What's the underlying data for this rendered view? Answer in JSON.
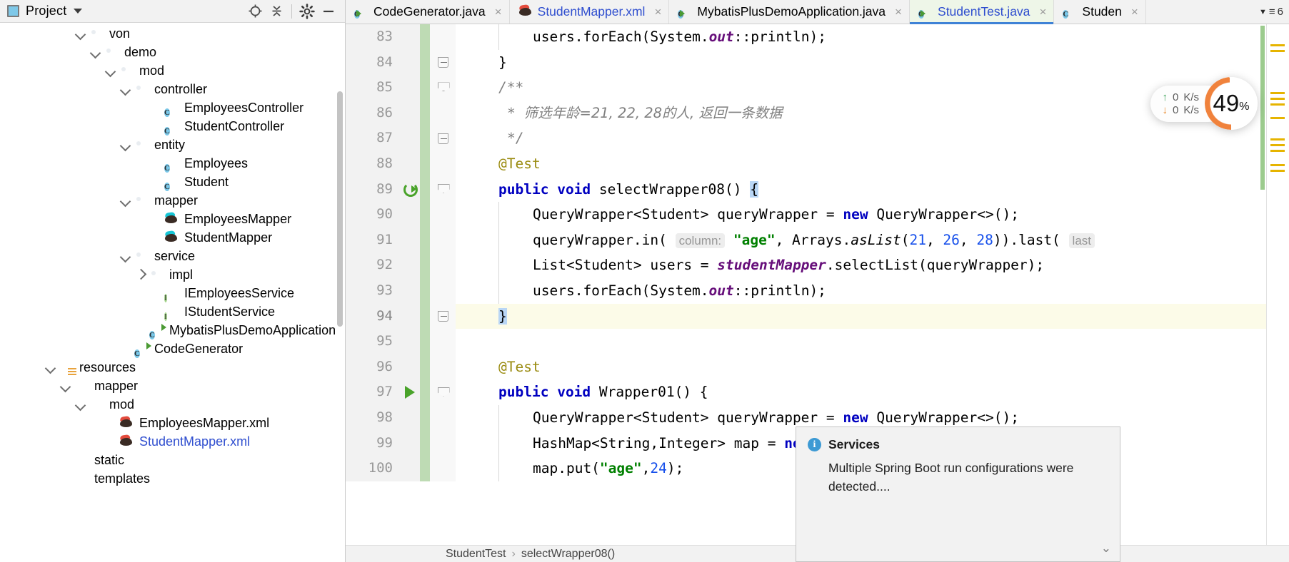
{
  "project_panel": {
    "title": "Project",
    "header_icons": [
      "project-window-icon",
      "chevron-down-icon",
      "locate-icon",
      "collapse-all-icon",
      "gear-icon",
      "minimize-icon"
    ],
    "tree": [
      {
        "label": "von",
        "indent": 5,
        "arrow": "down",
        "icon": "folder",
        "link": false
      },
      {
        "label": "demo",
        "indent": 6,
        "arrow": "down",
        "icon": "folder",
        "link": false
      },
      {
        "label": "mod",
        "indent": 7,
        "arrow": "down",
        "icon": "folder",
        "link": false
      },
      {
        "label": "controller",
        "indent": 8,
        "arrow": "down",
        "icon": "folder",
        "link": false
      },
      {
        "label": "EmployeesController",
        "indent": 10,
        "arrow": "none",
        "icon": "class",
        "link": false
      },
      {
        "label": "StudentController",
        "indent": 10,
        "arrow": "none",
        "icon": "class",
        "link": false
      },
      {
        "label": "entity",
        "indent": 8,
        "arrow": "down",
        "icon": "folder",
        "link": false
      },
      {
        "label": "Employees",
        "indent": 10,
        "arrow": "none",
        "icon": "class",
        "link": false
      },
      {
        "label": "Student",
        "indent": 10,
        "arrow": "none",
        "icon": "class",
        "link": false
      },
      {
        "label": "mapper",
        "indent": 8,
        "arrow": "down",
        "icon": "folder",
        "link": false
      },
      {
        "label": "EmployeesMapper",
        "indent": 10,
        "arrow": "none",
        "icon": "mybatis-cyan",
        "link": false
      },
      {
        "label": "StudentMapper",
        "indent": 10,
        "arrow": "none",
        "icon": "mybatis-cyan",
        "link": false
      },
      {
        "label": "service",
        "indent": 8,
        "arrow": "down",
        "icon": "folder",
        "link": false
      },
      {
        "label": "impl",
        "indent": 9,
        "arrow": "right",
        "icon": "folder",
        "link": false
      },
      {
        "label": "IEmployeesService",
        "indent": 10,
        "arrow": "none",
        "icon": "interface",
        "link": false
      },
      {
        "label": "IStudentService",
        "indent": 10,
        "arrow": "none",
        "icon": "interface",
        "link": false
      },
      {
        "label": "MybatisPlusDemoApplication",
        "indent": 9,
        "arrow": "none",
        "icon": "class-runnable",
        "link": false
      },
      {
        "label": "CodeGenerator",
        "indent": 8,
        "arrow": "none",
        "icon": "class-runnable",
        "link": false
      },
      {
        "label": "resources",
        "indent": 3,
        "arrow": "down",
        "icon": "folder-resources",
        "link": false
      },
      {
        "label": "mapper",
        "indent": 4,
        "arrow": "down",
        "icon": "folder-plain",
        "link": false
      },
      {
        "label": "mod",
        "indent": 5,
        "arrow": "down",
        "icon": "folder-plain",
        "link": false
      },
      {
        "label": "EmployeesMapper.xml",
        "indent": 7,
        "arrow": "none",
        "icon": "mybatis-red",
        "link": false
      },
      {
        "label": "StudentMapper.xml",
        "indent": 7,
        "arrow": "none",
        "icon": "mybatis-red",
        "link": true
      },
      {
        "label": "static",
        "indent": 4,
        "arrow": "none",
        "icon": "folder-plain",
        "link": false
      },
      {
        "label": "templates",
        "indent": 4,
        "arrow": "none",
        "icon": "folder-plain",
        "link": false
      }
    ]
  },
  "tabs": {
    "items": [
      {
        "label": "CodeGenerator.java",
        "icon": "class-runnable-icon",
        "link": false,
        "active": false,
        "close": "×"
      },
      {
        "label": "StudentMapper.xml",
        "icon": "mybatis-icon",
        "link": true,
        "active": false,
        "close": "×"
      },
      {
        "label": "MybatisPlusDemoApplication.java",
        "icon": "spring-class-icon",
        "link": false,
        "active": false,
        "close": "×"
      },
      {
        "label": "StudentTest.java",
        "icon": "test-class-icon",
        "link": true,
        "active": true,
        "close": "×"
      },
      {
        "label": "Studen",
        "icon": "class-icon",
        "link": false,
        "active": false,
        "close": "×"
      }
    ],
    "overflow_count": "6"
  },
  "editor": {
    "lines": [
      {
        "num": "83",
        "vcs": true,
        "fold": "none",
        "run": "none",
        "current": false,
        "guides": [
          1
        ]
      },
      {
        "num": "84",
        "vcs": true,
        "fold": "end",
        "run": "none",
        "current": false,
        "guides": []
      },
      {
        "num": "85",
        "vcs": true,
        "fold": "tri",
        "run": "none",
        "current": false,
        "guides": []
      },
      {
        "num": "86",
        "vcs": true,
        "fold": "none",
        "run": "none",
        "current": false,
        "guides": []
      },
      {
        "num": "87",
        "vcs": true,
        "fold": "end",
        "run": "none",
        "current": false,
        "guides": []
      },
      {
        "num": "88",
        "vcs": true,
        "fold": "none",
        "run": "none",
        "current": false,
        "guides": []
      },
      {
        "num": "89",
        "vcs": true,
        "fold": "tri",
        "run": "rerun",
        "current": false,
        "guides": []
      },
      {
        "num": "90",
        "vcs": true,
        "fold": "none",
        "run": "none",
        "current": false,
        "guides": [
          1
        ]
      },
      {
        "num": "91",
        "vcs": true,
        "fold": "none",
        "run": "none",
        "current": false,
        "guides": [
          1
        ]
      },
      {
        "num": "92",
        "vcs": true,
        "fold": "none",
        "run": "none",
        "current": false,
        "guides": [
          1
        ]
      },
      {
        "num": "93",
        "vcs": true,
        "fold": "none",
        "run": "none",
        "current": false,
        "guides": [
          1
        ]
      },
      {
        "num": "94",
        "vcs": true,
        "fold": "end",
        "run": "none",
        "current": true,
        "guides": []
      },
      {
        "num": "95",
        "vcs": true,
        "fold": "none",
        "run": "none",
        "current": false,
        "guides": []
      },
      {
        "num": "96",
        "vcs": true,
        "fold": "none",
        "run": "none",
        "current": false,
        "guides": []
      },
      {
        "num": "97",
        "vcs": true,
        "fold": "tri",
        "run": "play",
        "current": false,
        "guides": []
      },
      {
        "num": "98",
        "vcs": true,
        "fold": "none",
        "run": "none",
        "current": false,
        "guides": [
          1
        ]
      },
      {
        "num": "99",
        "vcs": true,
        "fold": "none",
        "run": "none",
        "current": false,
        "guides": [
          1
        ]
      },
      {
        "num": "100",
        "vcs": true,
        "fold": "none",
        "run": "none",
        "current": false,
        "guides": [
          1
        ]
      }
    ],
    "code": {
      "l83": "users.forEach(System.out::println);",
      "l84": "}",
      "l85": "/**",
      "l86_star": "*",
      "l86_text": "筛选年龄=21, 22, 28的人, 返回一条数据",
      "l87": "*/",
      "l88": "@Test",
      "l89_kw1": "public",
      "l89_kw2": "void",
      "l89_name": "selectWrapper08()",
      "l89_brace": "{",
      "l90_a": "QueryWrapper<Student> queryWrapper = ",
      "l90_new": "new",
      "l90_b": " QueryWrapper<>();",
      "l91_a": "queryWrapper.in(",
      "l91_hint": "column:",
      "l91_str": "\"age\"",
      "l91_b": ", Arrays.",
      "l91_m": "asList",
      "l91_c": "(",
      "l91_n1": "21",
      "l91_c2": ", ",
      "l91_n2": "26",
      "l91_c3": ", ",
      "l91_n3": "28",
      "l91_d": ")).last(",
      "l91_hint2": "last",
      "l92_a": "List<Student> users = ",
      "l92_field": "studentMapper",
      "l92_b": ".selectList(queryWrapper);",
      "l93": "users.forEach(System.out::println);",
      "l94": "}",
      "l95": "",
      "l96": "@Test",
      "l97_kw1": "public",
      "l97_kw2": "void",
      "l97_name": "Wrapper01() {",
      "l98_a": "QueryWrapper<Student> queryWrapper = ",
      "l98_new": "new",
      "l98_b": " QueryWrapper<>();",
      "l99_a": "HashMap<String,Integer> map = ",
      "l99_new": "ne",
      "l100_a": "map.put(",
      "l100_str": "\"age\"",
      "l100_c": ",",
      "l100_num": "24",
      "l100_d": ");"
    }
  },
  "perf_widget": {
    "upload": "0",
    "upload_unit": "K/s",
    "download": "0",
    "download_unit": "K/s",
    "cpu_value": "49",
    "cpu_unit": "%",
    "ring_color": "#f0823c"
  },
  "services_balloon": {
    "title": "Services",
    "message": "Multiple Spring Boot run configurations were detected....",
    "expand_icon": "chevron-down-icon"
  },
  "breadcrumb": {
    "items": [
      "StudentTest",
      "selectWrapper08()"
    ],
    "separator": "›"
  }
}
